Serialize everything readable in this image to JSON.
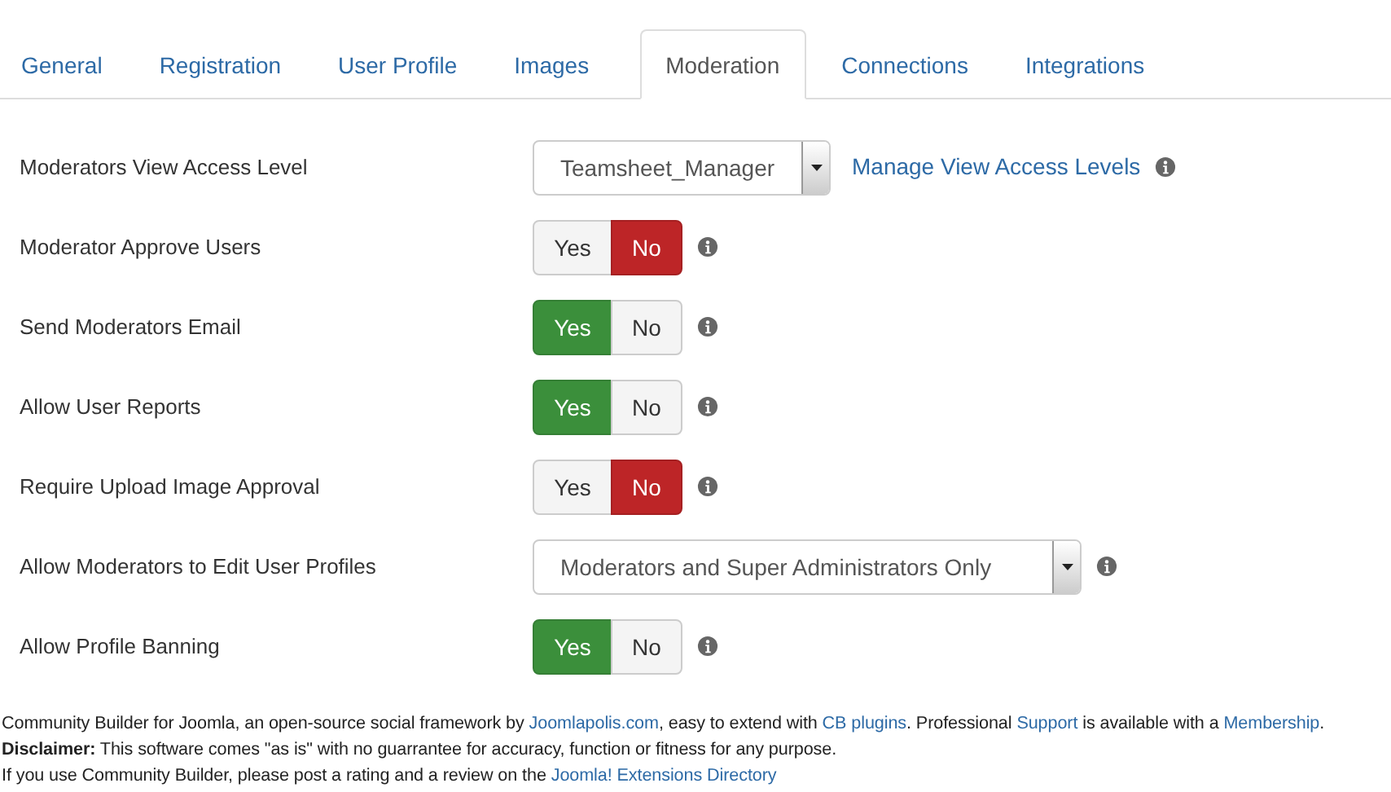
{
  "tabs": [
    {
      "label": "General",
      "selected": false
    },
    {
      "label": "Registration",
      "selected": false
    },
    {
      "label": "User Profile",
      "selected": false
    },
    {
      "label": "Images",
      "selected": false
    },
    {
      "label": "Moderation",
      "selected": true
    },
    {
      "label": "Connections",
      "selected": false
    },
    {
      "label": "Integrations",
      "selected": false
    }
  ],
  "settings": [
    {
      "kind": "select",
      "label": "Moderators View Access Level",
      "value": "Teamsheet_Manager",
      "link": "Manage View Access Levels"
    },
    {
      "kind": "toggle",
      "label": "Moderator Approve Users",
      "options": [
        {
          "label": "Yes",
          "selected": false
        },
        {
          "label": "No",
          "selected": true
        }
      ]
    },
    {
      "kind": "toggle",
      "label": "Send Moderators Email",
      "options": [
        {
          "label": "Yes",
          "selected": true
        },
        {
          "label": "No",
          "selected": false
        }
      ]
    },
    {
      "kind": "toggle",
      "label": "Allow User Reports",
      "options": [
        {
          "label": "Yes",
          "selected": true
        },
        {
          "label": "No",
          "selected": false
        }
      ]
    },
    {
      "kind": "toggle",
      "label": "Require Upload Image Approval",
      "options": [
        {
          "label": "Yes",
          "selected": false
        },
        {
          "label": "No",
          "selected": true
        }
      ]
    },
    {
      "kind": "select",
      "label": "Allow Moderators to Edit User Profiles",
      "value": "Moderators and Super Administrators Only"
    },
    {
      "kind": "toggle",
      "label": "Allow Profile Banning",
      "options": [
        {
          "label": "Yes",
          "selected": true
        },
        {
          "label": "No",
          "selected": false
        }
      ]
    }
  ],
  "footer": [
    [
      {
        "kind": "text",
        "text": "Community Builder for Joomla, an open-source social framework by "
      },
      {
        "kind": "link",
        "text": "Joomlapolis.com"
      },
      {
        "kind": "text",
        "text": ", easy to extend with "
      },
      {
        "kind": "link",
        "text": "CB plugins"
      },
      {
        "kind": "text",
        "text": ". Professional "
      },
      {
        "kind": "link",
        "text": "Support"
      },
      {
        "kind": "text",
        "text": " is available with a "
      },
      {
        "kind": "link",
        "text": "Membership"
      },
      {
        "kind": "text",
        "text": "."
      }
    ],
    [
      {
        "kind": "text",
        "text": "**Disclaimer:** This software comes \"as is\" with no guarrantee for accuracy, function or fitness for any purpose."
      }
    ],
    [
      {
        "kind": "text",
        "text": "If you use Community Builder, please post a rating and a review on the "
      },
      {
        "kind": "link",
        "text": "Joomla! Extensions Directory"
      }
    ]
  ]
}
